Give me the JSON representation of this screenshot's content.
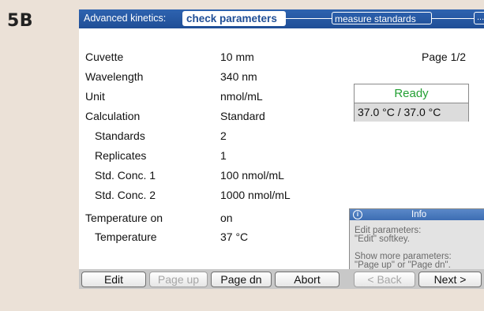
{
  "figure_label": "5B",
  "header": {
    "title": "Advanced kinetics:",
    "active_step": "check parameters",
    "next_step": "measure standards",
    "more": "..."
  },
  "page": "Page 1/2",
  "params": [
    {
      "label": "Cuvette",
      "value": "10 mm"
    },
    {
      "label": "Wavelength",
      "value": "340 nm"
    },
    {
      "label": "Unit",
      "value": "nmol/mL"
    },
    {
      "label": "Calculation",
      "value": "Standard"
    },
    {
      "label": "Standards",
      "value": "2"
    },
    {
      "label": "Replicates",
      "value": "1"
    },
    {
      "label": "Std. Conc. 1",
      "value": "100 nmol/mL"
    },
    {
      "label": "Std. Conc. 2",
      "value": "1000 nmol/mL"
    },
    {
      "label": "Temperature on",
      "value": "on"
    },
    {
      "label": "Temperature",
      "value": "37 °C"
    }
  ],
  "status": {
    "state": "Ready",
    "state_color": "#23a033",
    "temperature": "37.0 °C / 37.0 °C"
  },
  "info": {
    "title": "Info",
    "icon": "info-icon",
    "line1": "Edit parameters:",
    "line2": "\"Edit\" softkey.",
    "line3": "Show more parameters:",
    "line4": "\"Page up\" or \"Page dn\"."
  },
  "softkeys": [
    {
      "label": "Edit",
      "enabled": true
    },
    {
      "label": "Page up",
      "enabled": false
    },
    {
      "label": "Page dn",
      "enabled": true
    },
    {
      "label": "Abort",
      "enabled": true
    },
    {
      "label": "< Back",
      "enabled": false
    },
    {
      "label": "Next >",
      "enabled": true
    }
  ]
}
